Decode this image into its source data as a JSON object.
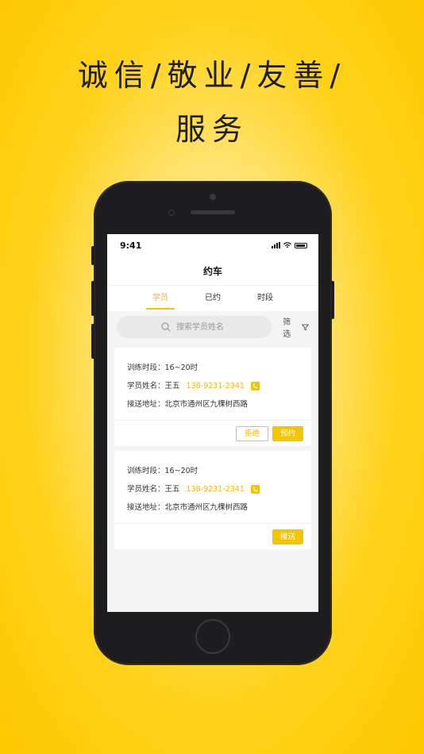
{
  "headline": {
    "line1": "诚信/敬业/友善/",
    "line2": "服务"
  },
  "status": {
    "time": "9:41"
  },
  "nav": {
    "title": "约车"
  },
  "tabs": [
    {
      "label": "学员",
      "active": true
    },
    {
      "label": "已约",
      "active": false
    },
    {
      "label": "时段",
      "active": false
    }
  ],
  "search": {
    "placeholder": "搜索学员姓名"
  },
  "filter": {
    "label": "筛选"
  },
  "cards": [
    {
      "period_label": "训练时段：",
      "period": "16~20时",
      "name_label": "学员姓名：",
      "name": "王五",
      "phone": "138-9231-2341",
      "addr_label": "接送地址：",
      "addr": "北京市通州区九棵树西路",
      "actions": [
        "拒绝",
        "预约"
      ]
    },
    {
      "period_label": "训练时段：",
      "period": "16~20时",
      "name_label": "学员姓名：",
      "name": "王五",
      "phone": "138-9231-2341",
      "addr_label": "接送地址：",
      "addr": "北京市通州区九棵树西路",
      "actions": [
        "接送"
      ]
    }
  ],
  "colors": {
    "brand": "#ffc800",
    "accent": "#f5c400",
    "text": "#333333"
  }
}
